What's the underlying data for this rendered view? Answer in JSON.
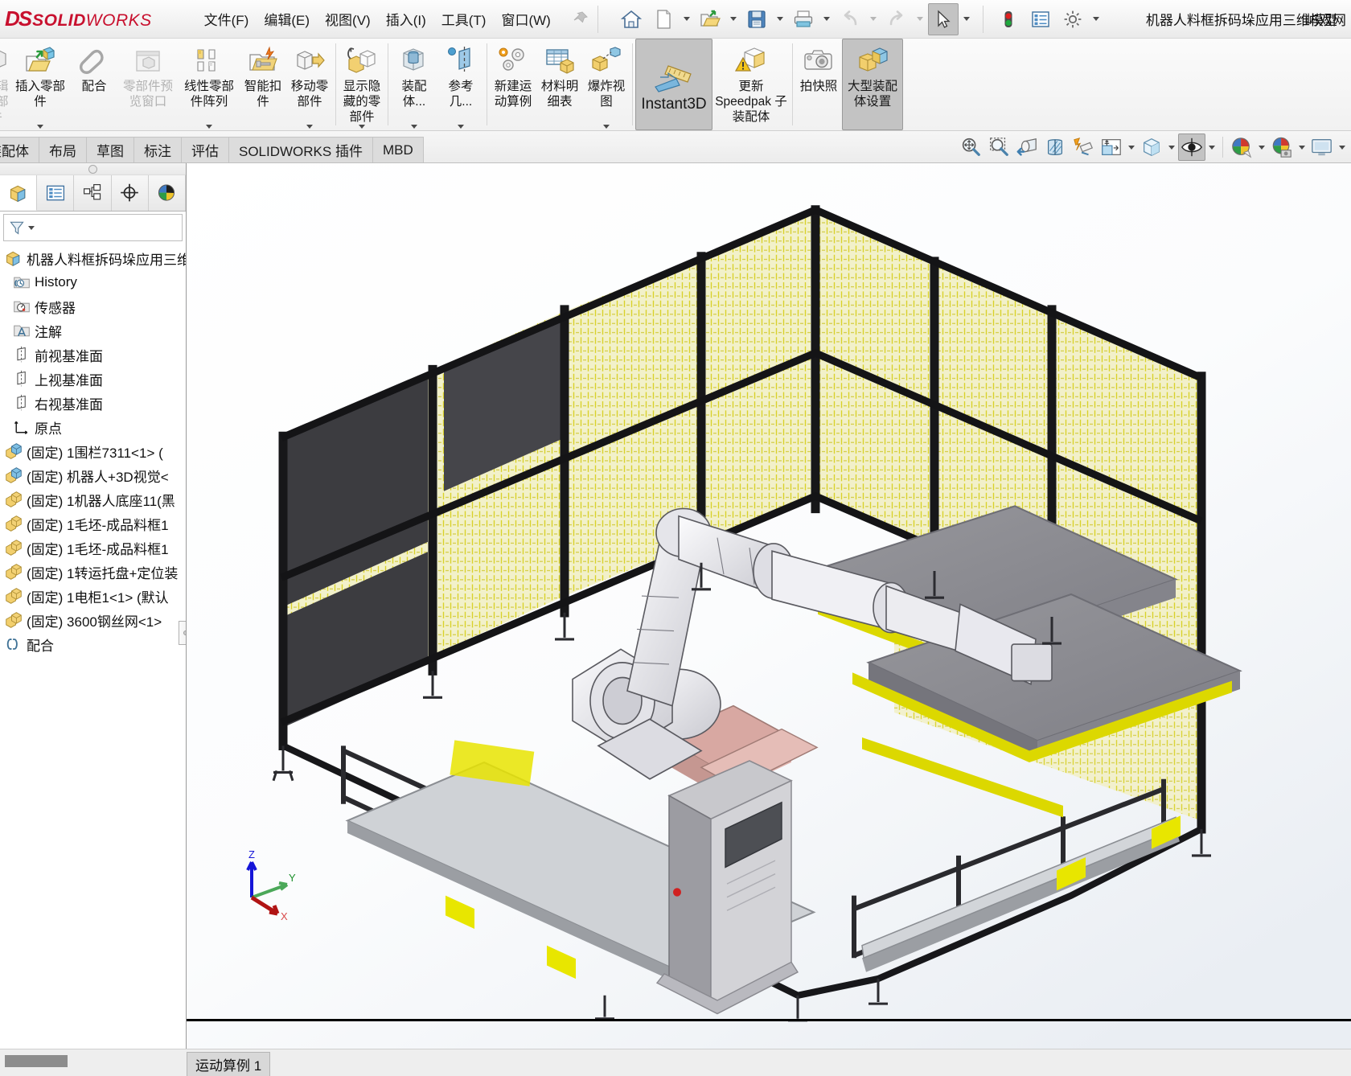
{
  "app": {
    "brand_mark": "DS",
    "brand_solid": "SOLID",
    "brand_works": "WORKS",
    "document_title": "机器人料框拆码垛应用三维模型",
    "user_name": "屿双网"
  },
  "menubar": {
    "items": [
      {
        "label": "文件(F)",
        "name": "menu-file"
      },
      {
        "label": "编辑(E)",
        "name": "menu-edit"
      },
      {
        "label": "视图(V)",
        "name": "menu-view"
      },
      {
        "label": "插入(I)",
        "name": "menu-insert"
      },
      {
        "label": "工具(T)",
        "name": "menu-tools"
      },
      {
        "label": "窗口(W)",
        "name": "menu-window"
      }
    ],
    "quick_access": [
      {
        "name": "home-icon",
        "title": "主页"
      },
      {
        "name": "new-document-icon",
        "title": "新建"
      },
      {
        "name": "open-folder-icon",
        "title": "打开"
      },
      {
        "name": "save-icon",
        "title": "保存"
      },
      {
        "name": "print-icon",
        "title": "打印"
      },
      {
        "name": "undo-icon",
        "title": "撤销"
      },
      {
        "name": "redo-icon",
        "title": "重做"
      },
      {
        "name": "select-cursor-icon",
        "title": "选择"
      },
      {
        "name": "rebuild-traffic-light-icon",
        "title": "重建模型"
      },
      {
        "name": "options-list-icon",
        "title": "选项列表"
      },
      {
        "name": "gear-icon",
        "title": "选项"
      }
    ]
  },
  "ribbon": {
    "buttons": [
      {
        "label": "编辑零部件",
        "name": "ribbon-edit-component",
        "icon": "edit-component-icon",
        "disabled": true,
        "dropdown": false,
        "selected": false,
        "width": "clip"
      },
      {
        "label": "插入零部件",
        "name": "ribbon-insert-component",
        "icon": "insert-component-icon",
        "disabled": false,
        "dropdown": true,
        "selected": false,
        "width": "wide"
      },
      {
        "label": "配合",
        "name": "ribbon-mate",
        "icon": "paperclip-mate-icon",
        "disabled": false,
        "dropdown": false,
        "selected": false,
        "width": "normal"
      },
      {
        "label": "零部件预览窗口",
        "name": "ribbon-component-preview-window",
        "icon": "component-preview-icon",
        "disabled": true,
        "dropdown": false,
        "selected": false,
        "width": "wide"
      },
      {
        "label": "线性零部件阵列",
        "name": "ribbon-linear-component-pattern",
        "icon": "linear-pattern-icon",
        "disabled": false,
        "dropdown": true,
        "selected": false,
        "width": "wide"
      },
      {
        "label": "智能扣件",
        "name": "ribbon-smart-fasteners",
        "icon": "smart-fastener-icon",
        "disabled": false,
        "dropdown": false,
        "selected": false,
        "width": "normal"
      },
      {
        "label": "移动零部件",
        "name": "ribbon-move-component",
        "icon": "move-component-icon",
        "disabled": false,
        "dropdown": true,
        "selected": false,
        "width": "normal"
      },
      {
        "label": "显示隐藏的零部件",
        "name": "ribbon-show-hidden-components",
        "icon": "show-hidden-components-icon",
        "disabled": false,
        "dropdown": true,
        "selected": false,
        "width": "normal"
      },
      {
        "label": "装配体...",
        "name": "ribbon-assembly-features",
        "icon": "assembly-feature-icon",
        "disabled": false,
        "dropdown": true,
        "selected": false,
        "width": "normal"
      },
      {
        "label": "参考几...",
        "name": "ribbon-reference-geometry",
        "icon": "reference-geometry-icon",
        "disabled": false,
        "dropdown": true,
        "selected": false,
        "width": "normal"
      },
      {
        "label": "新建运动算例",
        "name": "ribbon-new-motion-study",
        "icon": "motion-study-icon",
        "disabled": false,
        "dropdown": false,
        "selected": false,
        "width": "normal"
      },
      {
        "label": "材料明细表",
        "name": "ribbon-bill-of-materials",
        "icon": "bom-table-icon",
        "disabled": false,
        "dropdown": false,
        "selected": false,
        "width": "normal"
      },
      {
        "label": "爆炸视图",
        "name": "ribbon-exploded-view",
        "icon": "exploded-view-icon",
        "disabled": false,
        "dropdown": true,
        "selected": false,
        "width": "normal"
      },
      {
        "label": "Instant3D",
        "name": "ribbon-instant3d",
        "icon": "instant3d-ruler-icon",
        "disabled": false,
        "dropdown": false,
        "selected": true,
        "width": "xwide"
      },
      {
        "label": "更新 Speedpak 子装配体",
        "name": "ribbon-update-speedpak",
        "icon": "update-speedpak-icon",
        "disabled": false,
        "dropdown": false,
        "selected": false,
        "width": "xwide"
      },
      {
        "label": "拍快照",
        "name": "ribbon-take-snapshot",
        "icon": "camera-icon",
        "disabled": false,
        "dropdown": false,
        "selected": false,
        "width": "normal"
      },
      {
        "label": "大型装配体设置",
        "name": "ribbon-large-assembly-settings",
        "icon": "large-assembly-icon",
        "disabled": false,
        "dropdown": false,
        "selected": true,
        "width": "wide"
      }
    ]
  },
  "command_tabs": {
    "tabs": [
      {
        "label": "装配体",
        "name": "tab-assembly",
        "active": false
      },
      {
        "label": "布局",
        "name": "tab-layout",
        "active": false
      },
      {
        "label": "草图",
        "name": "tab-sketch",
        "active": false
      },
      {
        "label": "标注",
        "name": "tab-markup",
        "active": false
      },
      {
        "label": "评估",
        "name": "tab-evaluate",
        "active": false
      },
      {
        "label": "SOLIDWORKS 插件",
        "name": "tab-solidworks-addins",
        "active": false
      },
      {
        "label": "MBD",
        "name": "tab-mbd",
        "active": false
      }
    ],
    "view_tools": [
      {
        "name": "zoom-to-fit-icon",
        "dropdown": false,
        "selected": false
      },
      {
        "name": "zoom-to-area-icon",
        "dropdown": false,
        "selected": false
      },
      {
        "name": "previous-view-icon",
        "dropdown": false,
        "selected": false
      },
      {
        "name": "section-view-icon",
        "dropdown": false,
        "selected": false
      },
      {
        "name": "dynamic-annotation-icon",
        "dropdown": false,
        "selected": false
      },
      {
        "name": "view-orientation-icon",
        "dropdown": true,
        "selected": false
      },
      {
        "name": "display-style-icon",
        "dropdown": true,
        "selected": false
      },
      {
        "name": "hide-show-items-icon",
        "dropdown": true,
        "selected": true
      },
      {
        "name": "edit-appearance-icon",
        "dropdown": true,
        "selected": false
      },
      {
        "name": "apply-scene-icon",
        "dropdown": true,
        "selected": false
      },
      {
        "name": "view-settings-icon",
        "dropdown": true,
        "selected": false
      }
    ]
  },
  "feature_manager": {
    "tabs": [
      {
        "name": "fm-tab-feature-tree",
        "icon": "feature-tree-icon",
        "active": true
      },
      {
        "name": "fm-tab-property-manager",
        "icon": "property-manager-icon",
        "active": false
      },
      {
        "name": "fm-tab-configuration-manager",
        "icon": "configuration-manager-icon",
        "active": false
      },
      {
        "name": "fm-tab-dimxpert-manager",
        "icon": "dimxpert-icon",
        "active": false
      },
      {
        "name": "fm-tab-display-manager",
        "icon": "display-manager-icon",
        "active": false
      }
    ],
    "filter_placeholder": "",
    "tree": [
      {
        "label": "机器人料框拆码垛应用三维模",
        "icon": "assembly-root-icon",
        "indent": 0,
        "name": "tree-item-assembly-root"
      },
      {
        "label": "History",
        "icon": "history-folder-icon",
        "indent": 1,
        "name": "tree-item-history"
      },
      {
        "label": "传感器",
        "icon": "sensors-folder-icon",
        "indent": 1,
        "name": "tree-item-sensors"
      },
      {
        "label": "注解",
        "icon": "annotations-folder-icon",
        "indent": 1,
        "name": "tree-item-annotations"
      },
      {
        "label": "前视基准面",
        "icon": "plane-icon",
        "indent": 1,
        "name": "tree-item-front-plane"
      },
      {
        "label": "上视基准面",
        "icon": "plane-icon",
        "indent": 1,
        "name": "tree-item-top-plane"
      },
      {
        "label": "右视基准面",
        "icon": "plane-icon",
        "indent": 1,
        "name": "tree-item-right-plane"
      },
      {
        "label": "原点",
        "icon": "origin-icon",
        "indent": 1,
        "name": "tree-item-origin"
      },
      {
        "label": "(固定) 1围栏7311<1> (",
        "icon": "component-blue-icon",
        "indent": 0,
        "name": "tree-item-component-fence"
      },
      {
        "label": "(固定) 机器人+3D视觉<",
        "icon": "component-blue-icon",
        "indent": 0,
        "name": "tree-item-component-robot-vision"
      },
      {
        "label": "(固定) 1机器人底座11(黑",
        "icon": "component-yellow-icon",
        "indent": 0,
        "name": "tree-item-component-robot-base"
      },
      {
        "label": "(固定) 1毛坯-成品料框1",
        "icon": "component-yellow-icon",
        "indent": 0,
        "name": "tree-item-component-blank-bin-1"
      },
      {
        "label": "(固定) 1毛坯-成品料框1",
        "icon": "component-yellow-icon",
        "indent": 0,
        "name": "tree-item-component-blank-bin-2"
      },
      {
        "label": "(固定) 1转运托盘+定位装",
        "icon": "component-yellow-icon",
        "indent": 0,
        "name": "tree-item-component-transfer-pallet"
      },
      {
        "label": "(固定) 1电柜1<1> (默认",
        "icon": "component-yellow-icon",
        "indent": 0,
        "name": "tree-item-component-cabinet"
      },
      {
        "label": "(固定) 3600钢丝网<1>",
        "icon": "component-yellow-icon",
        "indent": 0,
        "name": "tree-item-component-wire-mesh"
      },
      {
        "label": "配合",
        "icon": "mates-folder-icon",
        "indent": 0,
        "name": "tree-item-mates"
      }
    ]
  },
  "viewport": {
    "triad_labels": {
      "x": "X",
      "y": "Y",
      "z": "Z"
    },
    "colors": {
      "frame_black": "#1a1a1a",
      "mesh_yellow": "#e8e24a",
      "panel_dark": "#3a3a3e",
      "table_gray": "#8b8b90",
      "robot_white": "#e9e9ec",
      "accent_yellow": "#e4e000",
      "base_pink": "#e2b6b0",
      "background": "#f7f9fb"
    }
  },
  "statusbar": {
    "motion_study_tabs": [
      {
        "label": "运动算例 1",
        "name": "motion-study-tab-1"
      }
    ]
  }
}
